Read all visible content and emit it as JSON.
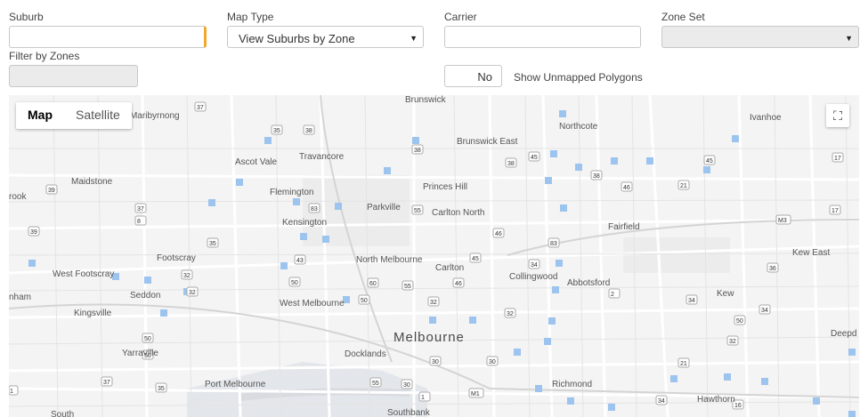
{
  "filters": {
    "suburb_label": "Suburb",
    "map_type_label": "Map Type",
    "map_type_value": "View Suburbs by Zone",
    "carrier_label": "Carrier",
    "zone_set_label": "Zone Set",
    "filter_zones_label": "Filter by Zones",
    "unmapped_toggle_value": "No",
    "unmapped_label": "Show Unmapped Polygons"
  },
  "map": {
    "map_tab": "Map",
    "satellite_tab": "Satellite",
    "fullscreen_icon": "fullscreen-icon",
    "labels": {
      "melbourne": "Melbourne",
      "brunswick": "Brunswick",
      "maribyrnong": "Maribyrnong",
      "northcote": "Northcote",
      "ivanhoe": "Ivanhoe",
      "brunswick_east": "Brunswick East",
      "ascot_vale": "Ascot Vale",
      "travancore": "Travancore",
      "maidstone": "Maidstone",
      "flemington": "Flemington",
      "princes_hill": "Princes Hill",
      "carlton_north": "Carlton North",
      "parkville": "Parkville",
      "kensington": "Kensington",
      "fairfield": "Fairfield",
      "kew_east": "Kew East",
      "footscray": "Footscray",
      "west_footscray": "West Footscray",
      "north_melbourne": "North Melbourne",
      "carlton": "Carlton",
      "collingwood": "Collingwood",
      "abbotsford": "Abbotsford",
      "seddon": "Seddon",
      "kingsville": "Kingsville",
      "west_melbourne": "West Melbourne",
      "kew": "Kew",
      "yarraville": "Yarraville",
      "docklands": "Docklands",
      "deepdene": "Deepd",
      "port_melbourne": "Port Melbourne",
      "richmond": "Richmond",
      "hawthorn": "Hawthorn",
      "southbank": "Southbank",
      "south": "South",
      "rook": "rook",
      "nham": "nham"
    }
  }
}
